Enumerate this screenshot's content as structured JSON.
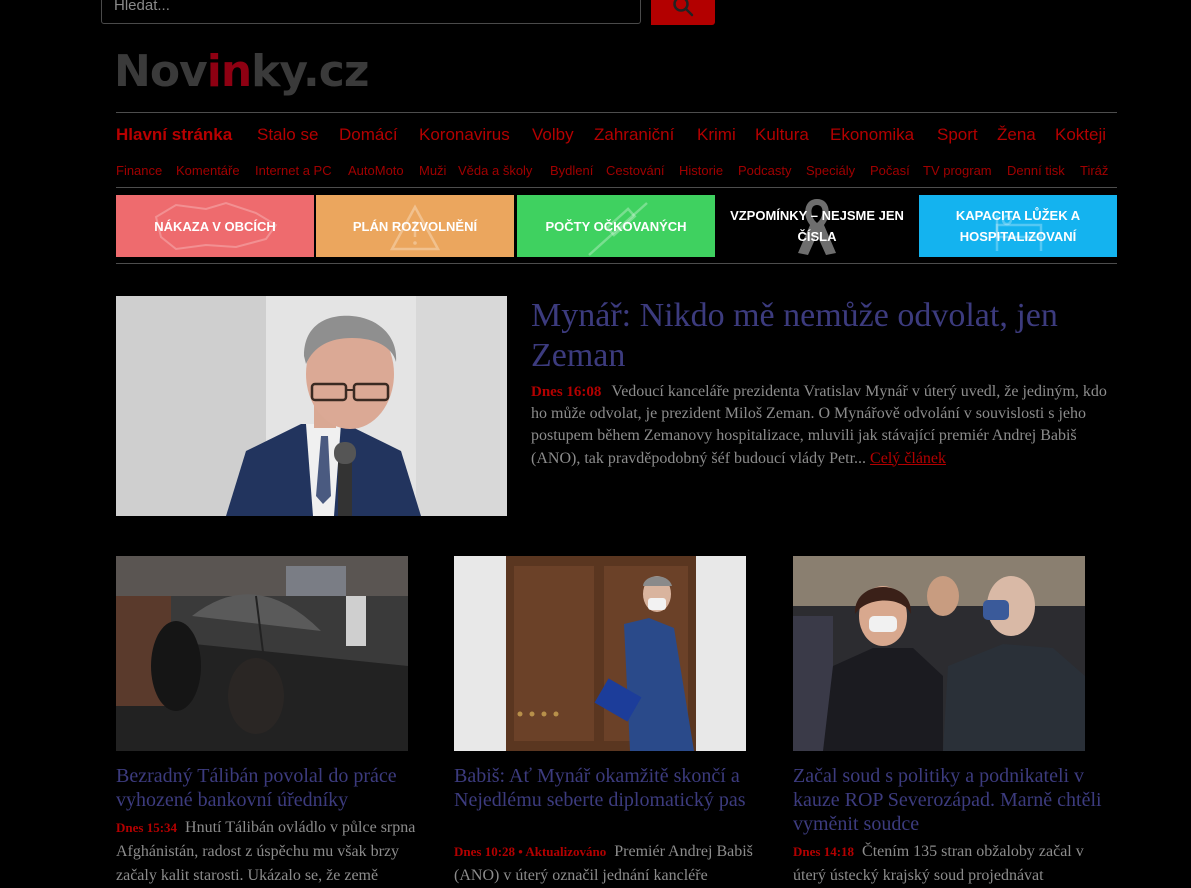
{
  "search": {
    "placeholder": "Hledat..."
  },
  "logo": {
    "part1": "Nov",
    "part2": "in",
    "part3": "ky.cz"
  },
  "nav": {
    "main": [
      "Hlavní stránka",
      "Stalo se",
      "Domácí",
      "Koronavirus",
      "Volby",
      "Zahraniční",
      "Krimi",
      "Kultura",
      "Ekonomika",
      "Sport",
      "Žena",
      "Kokteji"
    ],
    "sub": [
      "Finance",
      "Komentáře",
      "Internet a PC",
      "AutoMoto",
      "Muži",
      "Věda a školy",
      "Bydlení",
      "Cestování",
      "Historie",
      "Podcasty",
      "Speciály",
      "Počasí",
      "TV program",
      "Denní tisk",
      "Tiráž"
    ]
  },
  "banners": [
    {
      "label": "NÁKAZA V OBCÍCH",
      "color": "#ee6b6e",
      "icon": "czech-map-icon"
    },
    {
      "label": "PLÁN ROZVOLNĚNÍ",
      "color": "#eba65e",
      "icon": "warning-icon"
    },
    {
      "label": "POČTY OČKOVANÝCH",
      "color": "#3fd160",
      "icon": "syringe-icon"
    },
    {
      "label": "VZPOMÍNKY – NEJSME JEN ČÍSLA",
      "color": "#000000",
      "icon": "ribbon-icon"
    },
    {
      "label": "KAPACITA LŮŽEK A HOSPITALIZOVANÍ",
      "color": "#14b3ef",
      "icon": "hospital-bed-icon"
    }
  ],
  "lead": {
    "title": "Mynář: Nikdo mě nemůže odvolat, jen Zeman",
    "time": "Dnes 16:08",
    "text": "Vedoucí kanceláře prezidenta Vratislav Mynář v úterý uvedl, že jediným, kdo ho může odvolat, je prezident Miloš Zeman. O Mynářově odvolání v souvislosti s jeho postupem během Zemanovy hospitalizace, mluvili jak stávající premiér Andrej Babiš (ANO), tak pravděpodobný šéf budoucí vlády Petr...",
    "more": "Celý článek"
  },
  "cards": [
    {
      "title": "Bezradný Tálibán povolal do práce vyhozené bankovní úředníky",
      "time": "Dnes 15:34",
      "text": "Hnutí Tálibán ovládlo v půlce srpna Afghánistán, radost z úspěchu mu však brzy začaly kalit starosti. Ukázalo se, že země"
    },
    {
      "title": "Babiš: Ať Mynář okamžitě skončí a Nejedlému seberte diplomatický pas",
      "time": "Dnes 10:28 • Aktualizováno",
      "text": "Premiér Andrej Babiš (ANO) v úterý označil jednání kancléře"
    },
    {
      "title": "Začal soud s politiky a podnikateli v kauze ROP Severozápad. Marně chtěli vyměnit soudce",
      "time": "Dnes 14:18",
      "text": "Čtením 135 stran obžaloby začal v úterý ústecký krajský soud projednávat"
    }
  ]
}
